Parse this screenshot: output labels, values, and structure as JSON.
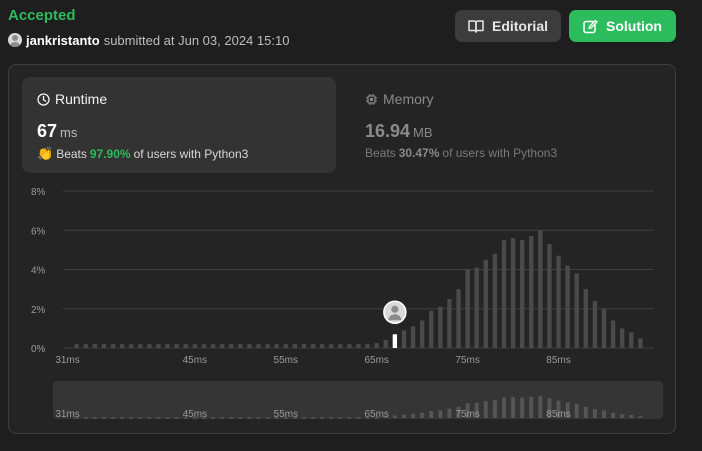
{
  "status": {
    "label": "Accepted",
    "color": "#2cbb5d"
  },
  "submission": {
    "username": "jankristanto",
    "submitted_text": "submitted at Jun 03, 2024 15:10"
  },
  "buttons": {
    "editorial": {
      "label": "Editorial",
      "icon": "book-icon"
    },
    "solution": {
      "label": "Solution",
      "icon": "edit-icon"
    }
  },
  "runtime": {
    "title": "Runtime",
    "icon": "clock-icon",
    "value": "67",
    "unit": "ms",
    "beats_label": "Beats",
    "beats_pct": "97.90%",
    "beats_suffix": "of users with Python3"
  },
  "memory": {
    "title": "Memory",
    "icon": "chip-icon",
    "value": "16.94",
    "unit": "MB",
    "beats_label": "Beats",
    "beats_pct": "30.47%",
    "beats_suffix": "of users with Python3"
  },
  "colors": {
    "accent": "#2cbb5d",
    "bar": "#4a4a4a",
    "highlight_bar": "#ffffff"
  },
  "chart_data": {
    "type": "bar",
    "title": "",
    "xlabel": "",
    "ylabel": "",
    "ylim": [
      0,
      8
    ],
    "ytick_labels": [
      "0%",
      "2%",
      "4%",
      "6%",
      "8%"
    ],
    "yticks": [
      0,
      2,
      4,
      6,
      8
    ],
    "xlim": [
      30.5,
      95.5
    ],
    "xtick_labels": [
      "31ms",
      "45ms",
      "55ms",
      "65ms",
      "75ms",
      "85ms"
    ],
    "xticks": [
      31,
      45,
      55,
      65,
      75,
      85
    ],
    "x": [
      32,
      33,
      34,
      35,
      36,
      37,
      38,
      39,
      40,
      41,
      42,
      43,
      44,
      45,
      46,
      47,
      48,
      49,
      50,
      51,
      52,
      53,
      54,
      55,
      56,
      57,
      58,
      59,
      60,
      61,
      62,
      63,
      64,
      65,
      66,
      67,
      68,
      69,
      70,
      71,
      72,
      73,
      74,
      75,
      76,
      77,
      78,
      79,
      80,
      81,
      82,
      83,
      84,
      85,
      86,
      87,
      88,
      89,
      90,
      91,
      92,
      93,
      94
    ],
    "values": [
      0.2,
      0.2,
      0.2,
      0.2,
      0.2,
      0.2,
      0.2,
      0.2,
      0.2,
      0.2,
      0.2,
      0.2,
      0.2,
      0.2,
      0.2,
      0.2,
      0.2,
      0.2,
      0.2,
      0.2,
      0.2,
      0.2,
      0.2,
      0.2,
      0.2,
      0.2,
      0.2,
      0.2,
      0.2,
      0.2,
      0.2,
      0.2,
      0.2,
      0.25,
      0.4,
      0.7,
      0.9,
      1.1,
      1.4,
      1.9,
      2.1,
      2.5,
      3.0,
      4.0,
      4.1,
      4.5,
      4.8,
      5.5,
      5.6,
      5.5,
      5.7,
      6.0,
      5.3,
      4.7,
      4.2,
      3.8,
      3.0,
      2.4,
      2.0,
      1.4,
      1.0,
      0.8,
      0.5
    ],
    "highlight": {
      "x": 67,
      "label": "user"
    }
  }
}
